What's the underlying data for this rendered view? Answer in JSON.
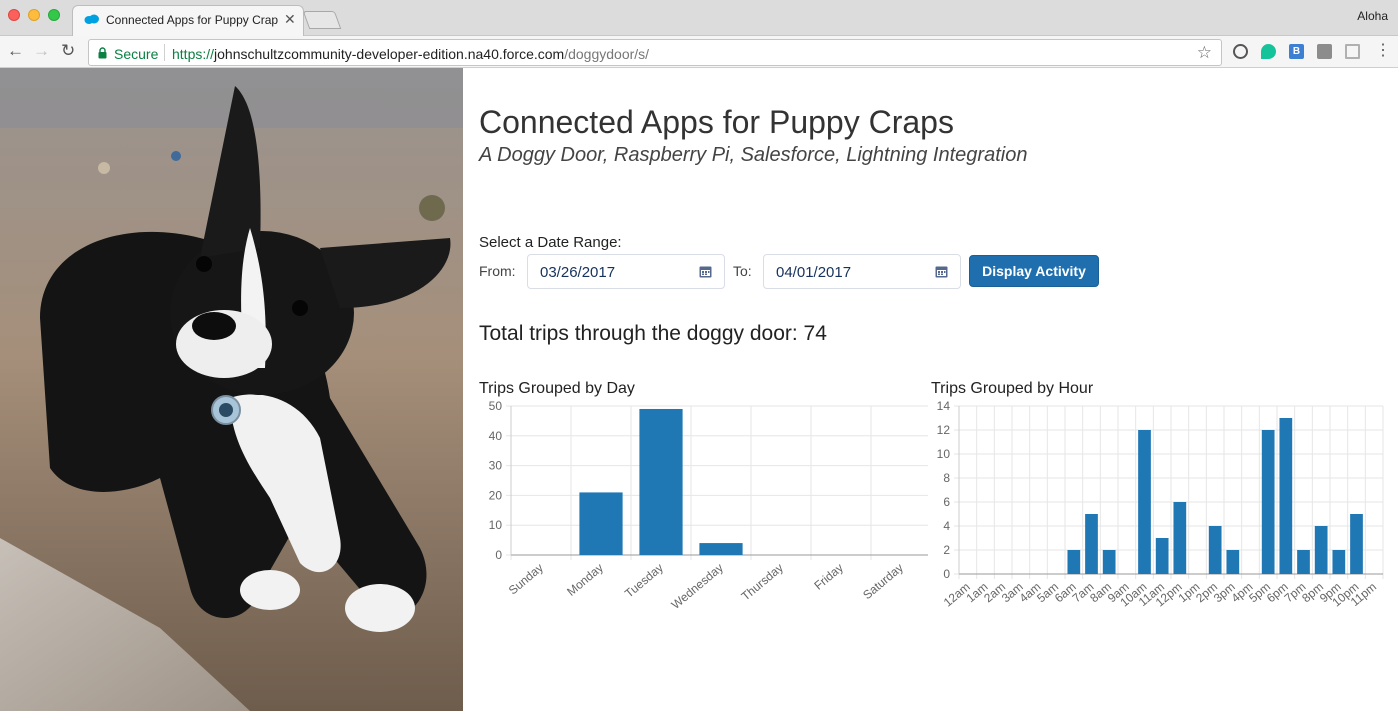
{
  "browser": {
    "tab_title": "Connected Apps for Puppy Craps",
    "profile_name": "Aloha",
    "secure_label": "Secure",
    "url_scheme": "https://",
    "url_host": "johnschultzcommunity-developer-edition.na40.force.com",
    "url_path": "/doggydoor/s/",
    "extension_badge": "B"
  },
  "page": {
    "title": "Connected Apps for Puppy Craps",
    "subtitle": "A Doggy Door, Raspberry Pi, Salesforce, Lightning Integration",
    "date_range_label": "Select a Date Range:",
    "from_label": "From:",
    "from_value": "03/26/2017",
    "to_label": "To:",
    "to_value": "04/01/2017",
    "display_button": "Display Activity",
    "total_trips_text": "Total trips through the doggy door: 74"
  },
  "colors": {
    "bar": "#1f77b4",
    "button": "#1f6faf",
    "grid": "#e6e6e6"
  },
  "chart_data": [
    {
      "type": "bar",
      "title": "Trips Grouped by Day",
      "categories": [
        "Sunday",
        "Monday",
        "Tuesday",
        "Wednesday",
        "Thursday",
        "Friday",
        "Saturday"
      ],
      "values": [
        0,
        21,
        49,
        4,
        0,
        0,
        0
      ],
      "ylim": [
        0,
        50
      ],
      "yticks": [
        0,
        10,
        20,
        30,
        40,
        50
      ],
      "grid": true,
      "xlabel": "",
      "ylabel": ""
    },
    {
      "type": "bar",
      "title": "Trips Grouped by Hour",
      "categories": [
        "12am",
        "1am",
        "2am",
        "3am",
        "4am",
        "5am",
        "6am",
        "7am",
        "8am",
        "9am",
        "10am",
        "11am",
        "12pm",
        "1pm",
        "2pm",
        "3pm",
        "4pm",
        "5pm",
        "6pm",
        "7pm",
        "8pm",
        "9pm",
        "10pm",
        "11pm"
      ],
      "values": [
        0,
        0,
        0,
        0,
        0,
        0,
        2,
        5,
        2,
        0,
        12,
        3,
        6,
        0,
        4,
        2,
        0,
        12,
        13,
        2,
        4,
        2,
        5,
        0
      ],
      "ylim": [
        0,
        14
      ],
      "yticks": [
        0,
        2,
        4,
        6,
        8,
        10,
        12,
        14
      ],
      "grid": true,
      "xlabel": "",
      "ylabel": ""
    }
  ]
}
